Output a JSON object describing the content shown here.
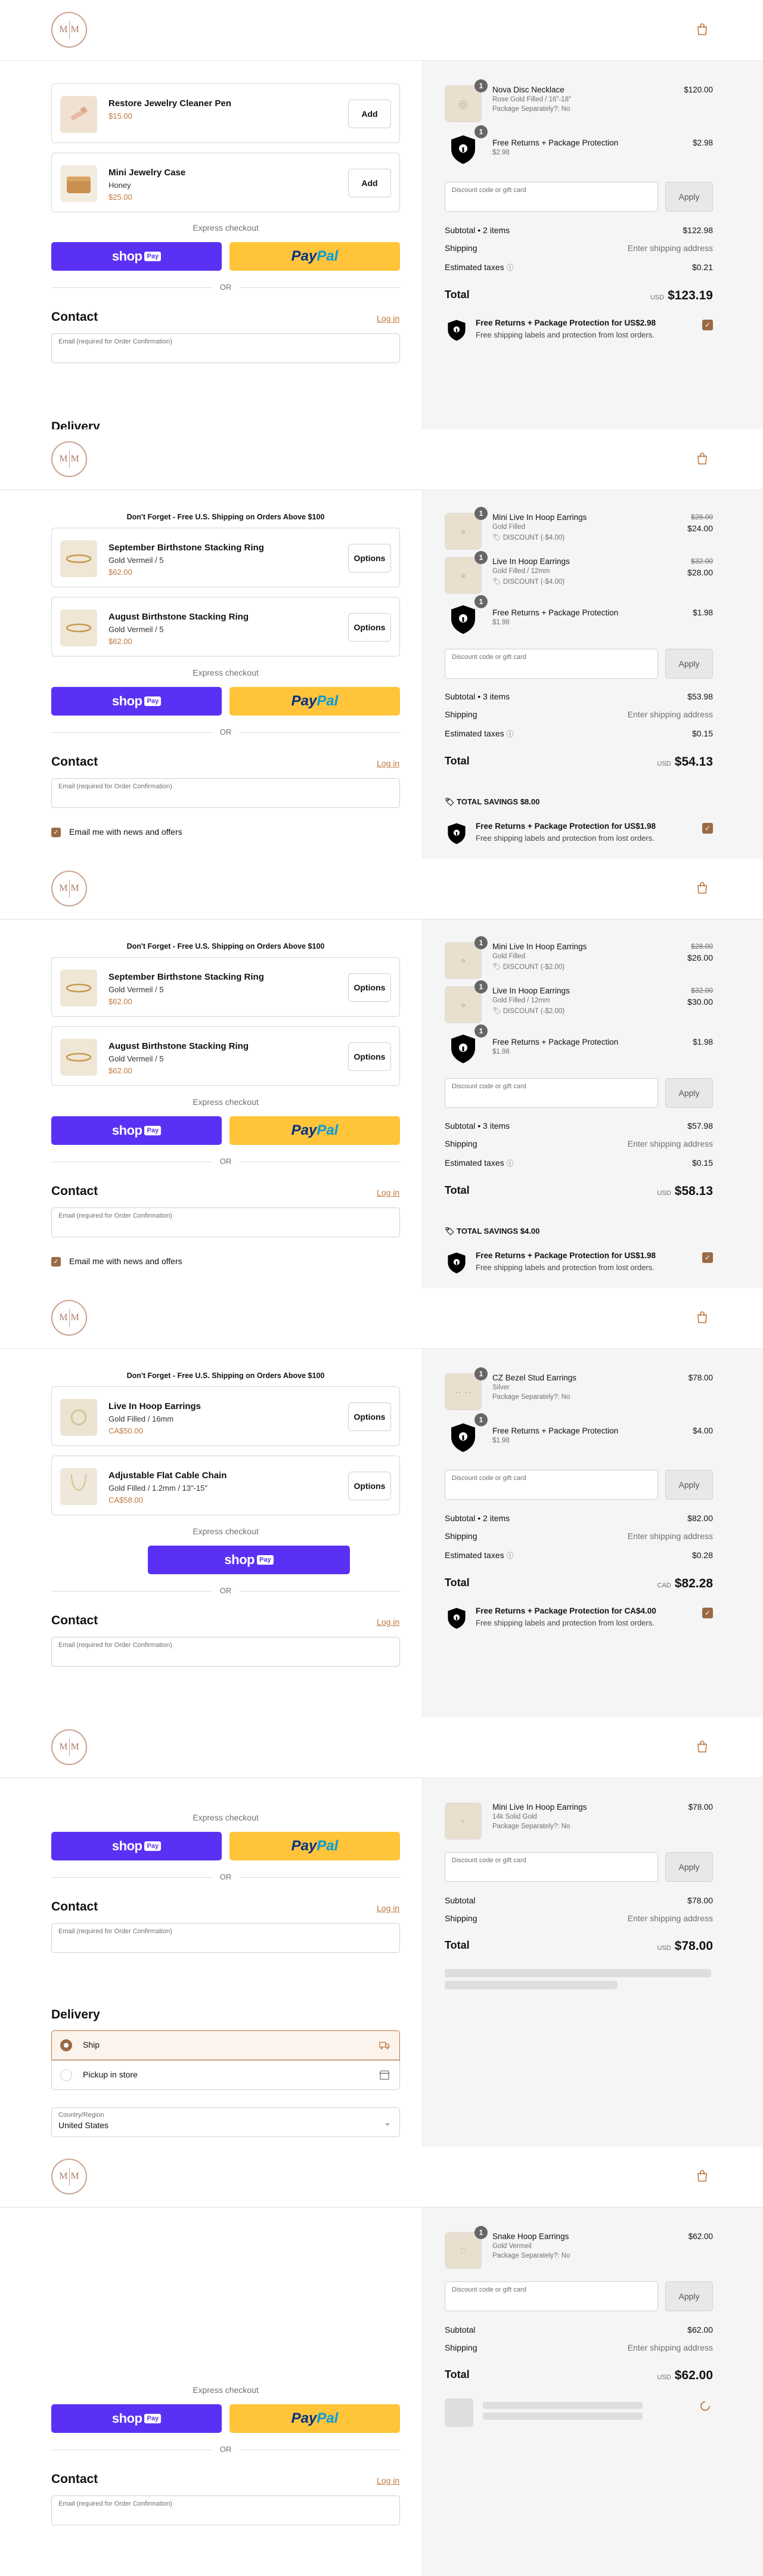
{
  "logo_text": "M",
  "label": {
    "express": "Express checkout",
    "or": "OR",
    "contact": "Contact",
    "login": "Log in",
    "email_placeholder": "Email (required for Order Confirmation)",
    "discount_placeholder": "Discount code or gift card",
    "apply": "Apply",
    "shipping": "Shipping",
    "enter_shipping": "Enter shipping address",
    "estimated_taxes": "Estimated taxes",
    "total": "Total",
    "subtotal": "Subtotal",
    "total_savings": "TOTAL SAVINGS",
    "delivery": "Delivery",
    "email_news": "Email me with news and offers",
    "free_shipping_banner": "Don't Forget - Free U.S. Shipping on Orders Above $100",
    "shop": "shop",
    "pay": "Pay",
    "paypal_a": "Pay",
    "paypal_b": "Pal",
    "protection_sub": "Free shipping labels and protection from lost orders."
  },
  "s1": {
    "upsells": [
      {
        "name": "Restore Jewelry Cleaner Pen",
        "sub": "",
        "price": "$15.00",
        "btn": "Add"
      },
      {
        "name": "Mini Jewelry Case",
        "sub": "Honey",
        "price": "$25.00",
        "btn": "Add"
      }
    ],
    "items": [
      {
        "qty": "1",
        "name": "Nova Disc Necklace",
        "sub1": "Rose Gold Filled / 16\"-18\"",
        "sub2": "Package Separately?: No",
        "price": "$120.00"
      },
      {
        "qty": "1",
        "name": "Free Returns + Package Protection",
        "sub1": "$2.98",
        "price": "$2.98"
      }
    ],
    "subtotal": "Subtotal • 2 items",
    "subtotal_val": "$122.98",
    "taxes": "$0.21",
    "currency": "USD",
    "total": "$123.19",
    "protection": "Free Returns + Package Protection for US$2.98"
  },
  "s2": {
    "upsells": [
      {
        "name": "September Birthstone Stacking Ring",
        "sub": "Gold Vermeil / 5",
        "price": "$62.00",
        "btn": "Options"
      },
      {
        "name": "August Birthstone Stacking Ring",
        "sub": "Gold Vermeil / 5",
        "price": "$62.00",
        "btn": "Options"
      }
    ],
    "items": [
      {
        "qty": "1",
        "name": "Mini Live In Hoop Earrings",
        "sub1": "Gold Filled",
        "disc": "DISCOUNT (-$4.00)",
        "old": "$28.00",
        "price": "$24.00"
      },
      {
        "qty": "1",
        "name": "Live In Hoop Earrings",
        "sub1": "Gold Filled / 12mm",
        "disc": "DISCOUNT (-$4.00)",
        "old": "$32.00",
        "price": "$28.00"
      },
      {
        "qty": "1",
        "name": "Free Returns + Package Protection",
        "sub1": "$1.98",
        "price": "$1.98"
      }
    ],
    "subtotal": "Subtotal • 3 items",
    "subtotal_val": "$53.98",
    "taxes": "$0.15",
    "currency": "USD",
    "total": "$54.13",
    "savings": "$8.00",
    "protection": "Free Returns + Package Protection for US$1.98"
  },
  "s3": {
    "upsells": [
      {
        "name": "September Birthstone Stacking Ring",
        "sub": "Gold Vermeil / 5",
        "price": "$62.00",
        "btn": "Options"
      },
      {
        "name": "August Birthstone Stacking Ring",
        "sub": "Gold Vermeil / 5",
        "price": "$62.00",
        "btn": "Options"
      }
    ],
    "items": [
      {
        "qty": "1",
        "name": "Mini Live In Hoop Earrings",
        "sub1": "Gold Filled",
        "disc": "DISCOUNT (-$2.00)",
        "old": "$28.00",
        "price": "$26.00"
      },
      {
        "qty": "1",
        "name": "Live In Hoop Earrings",
        "sub1": "Gold Filled / 12mm",
        "disc": "DISCOUNT (-$2.00)",
        "old": "$32.00",
        "price": "$30.00"
      },
      {
        "qty": "1",
        "name": "Free Returns + Package Protection",
        "sub1": "$1.98",
        "price": "$1.98"
      }
    ],
    "subtotal": "Subtotal • 3 items",
    "subtotal_val": "$57.98",
    "taxes": "$0.15",
    "currency": "USD",
    "total": "$58.13",
    "savings": "$4.00",
    "protection": "Free Returns + Package Protection for US$1.98"
  },
  "s4": {
    "upsells": [
      {
        "name": "Live In Hoop Earrings",
        "sub": "Gold Filled / 16mm",
        "price": "CA$50.00",
        "btn": "Options"
      },
      {
        "name": "Adjustable Flat Cable Chain",
        "sub": "Gold Filled / 1.2mm / 13\"-15\"",
        "price": "CA$58.00",
        "btn": "Options"
      }
    ],
    "items": [
      {
        "qty": "1",
        "name": "CZ Bezel Stud Earrings",
        "sub1": "Silver",
        "sub2": "Package Separately?: No",
        "price": "$78.00"
      },
      {
        "qty": "1",
        "name": "Free Returns + Package Protection",
        "sub1": "$1.98",
        "price": "$4.00"
      }
    ],
    "subtotal": "Subtotal • 2 items",
    "subtotal_val": "$82.00",
    "taxes": "$0.28",
    "currency": "CAD",
    "total": "$82.28",
    "protection": "Free Returns + Package Protection for CA$4.00"
  },
  "s5": {
    "items": [
      {
        "qty": "1",
        "name": "Mini Live In Hoop Earrings",
        "sub1": "14k Solid Gold",
        "sub2": "Package Separately?: No",
        "price": "$78.00"
      }
    ],
    "subtotal_val": "$78.00",
    "currency": "USD",
    "total": "$78.00",
    "ship_label": "Ship",
    "pickup_label": "Pickup in store",
    "country_label": "Country/Region",
    "country_value": "United States"
  },
  "s6": {
    "items": [
      {
        "qty": "1",
        "name": "Snake Hoop Earrings",
        "sub1": "Gold Vermeil",
        "sub2": "Package Separately?: No",
        "price": "$62.00"
      }
    ],
    "subtotal_val": "$62.00",
    "currency": "USD",
    "total": "$62.00"
  }
}
